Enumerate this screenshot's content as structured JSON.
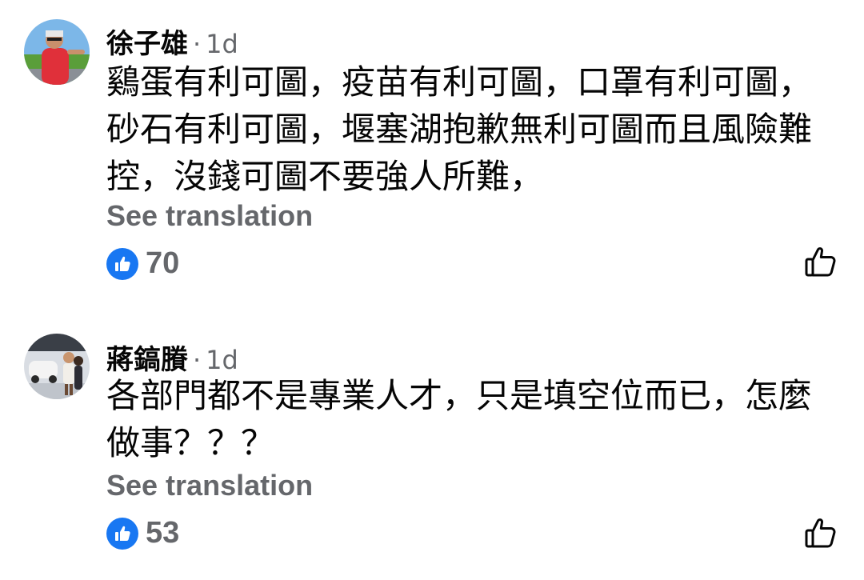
{
  "comments": [
    {
      "author": "徐子雄",
      "separator": "·",
      "time": "1d",
      "text": "鷄蛋有利可圖，疫苗有利可圖，口罩有利可圖，砂石有利可圖，堰塞湖抱歉無利可圖而且風險難控，沒錢可圖不要強人所難，",
      "translate_label": "See translation",
      "like_count": "70"
    },
    {
      "author": "蔣鎬賸",
      "separator": "·",
      "time": "1d",
      "text": "各部門都不是專業人才，只是填空位而已，怎麼做事？？？",
      "translate_label": "See translation",
      "like_count": "53"
    }
  ],
  "icons": {
    "reaction": "like-thumb-icon",
    "like_button": "thumbs-up-outline-icon"
  },
  "colors": {
    "like_blue": "#1877f2",
    "meta_gray": "#65676b",
    "text": "#050505"
  }
}
